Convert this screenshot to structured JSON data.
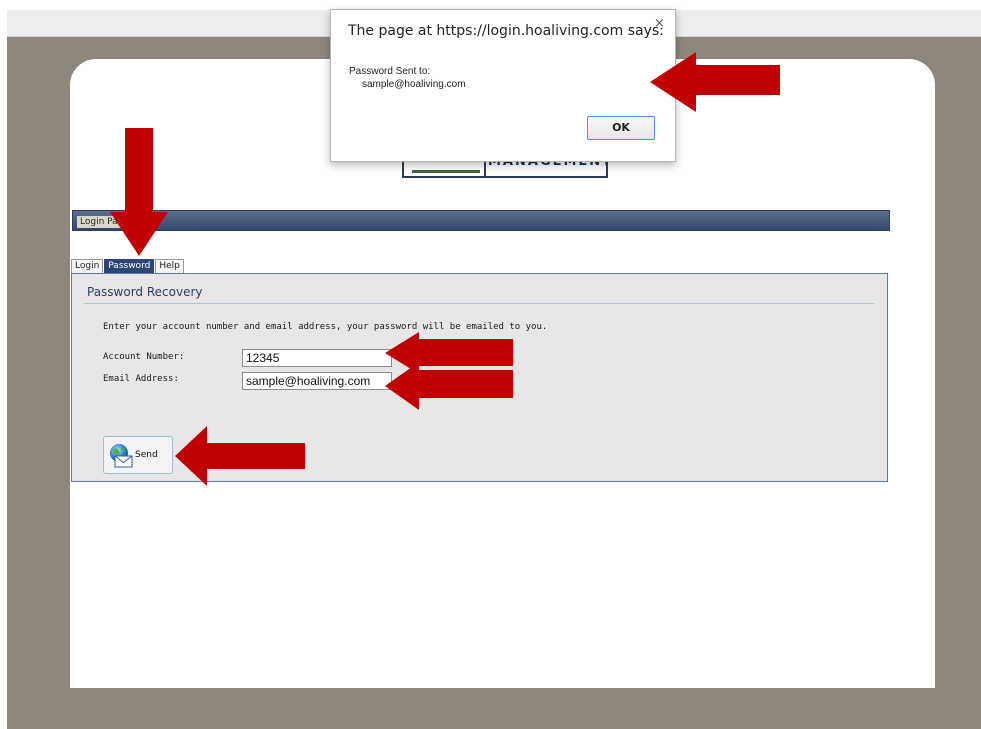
{
  "dialog": {
    "title": "The page at https://login.hoaliving.com says:",
    "close_glyph": "×",
    "message_line1": "Password Sent to:",
    "message_line2": "sample@hoaliving.com",
    "ok_label": "OK"
  },
  "logo": {
    "text": "MANAGEMENT"
  },
  "header": {
    "title": "Login Pa"
  },
  "tabs": [
    {
      "label": "Login",
      "active": false
    },
    {
      "label": "Password",
      "active": true
    },
    {
      "label": "Help",
      "active": false
    }
  ],
  "recovery": {
    "heading": "Password Recovery",
    "instructions": "Enter your account number and email address, your password will be emailed to you.",
    "account_label": "Account Number:",
    "account_value": "12345",
    "email_label": "Email Address:",
    "email_value": "sample@hoaliving.com",
    "send_label": "Send",
    "send_icon": "globe-mail-icon"
  },
  "annotations": {
    "arrow_color": "#c00000",
    "arrow_icon": "red-arrow-icon"
  },
  "colors": {
    "page_background": "#8c877a",
    "title_bar": "#34476a",
    "active_tab": "#2d4775",
    "panel_background": "#e7e7e7"
  }
}
